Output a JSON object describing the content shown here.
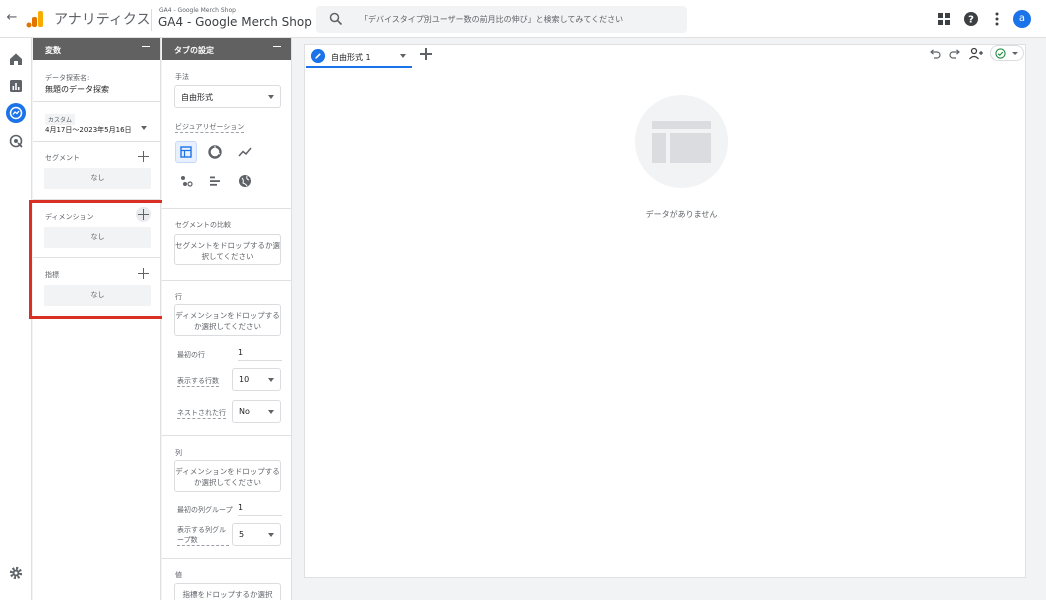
{
  "app": {
    "product_name": "アナリティクス",
    "property_small": "GA4 - Google Merch Shop",
    "property_big": "GA4 - Google Merch Shop",
    "search_placeholder": "「デバイスタイプ別ユーザー数の前月比の伸び」と検索してみてください",
    "avatar_letter": "a"
  },
  "colors": {
    "accent": "#1a73e8",
    "panel_header": "#616161",
    "highlight": "#d93025",
    "logo_orange": "#f9ab00",
    "logo_dark": "#e37400"
  },
  "nav_rail": {
    "icons": [
      "home-icon",
      "reports-icon",
      "explore-icon",
      "advertising-icon",
      "settings-icon"
    ],
    "active": "explore-icon"
  },
  "variables_panel": {
    "title": "変数",
    "exploration_name_label": "データ探索名:",
    "exploration_name": "無題のデータ探索",
    "date_chip": "カスタム",
    "date_range": "4月17日～2023年5月16日",
    "segment_label": "セグメント",
    "segment_value": "なし",
    "dimension_label": "ディメンション",
    "dimension_value": "なし",
    "metric_label": "指標",
    "metric_value": "なし"
  },
  "tab_settings": {
    "title": "タブの設定",
    "technique_label": "手法",
    "technique_value": "自由形式",
    "visualization_label": "ビジュアリゼーション",
    "visualization_icons": [
      "table-icon",
      "donut-chart-icon",
      "line-chart-icon",
      "scatter-plot-icon",
      "bar-chart-icon",
      "globe-icon"
    ],
    "segment_compare_label": "セグメントの比較",
    "segment_drop": "セグメントをドロップするか選択してください",
    "rows_label": "行",
    "rows_drop": "ディメンションをドロップするか選択してください",
    "first_row_label": "最初の行",
    "first_row_value": "1",
    "rows_count_label": "表示する行数",
    "rows_count_value": "10",
    "nested_rows_label": "ネストされた行",
    "nested_rows_value": "No",
    "columns_label": "列",
    "columns_drop": "ディメンションをドロップするか選択してください",
    "first_col_group_label": "最初の列グループ",
    "first_col_group_value": "1",
    "col_groups_label": "表示する列グループ数",
    "col_groups_value": "5",
    "values_label": "値",
    "values_drop": "指標をドロップするか選択"
  },
  "canvas": {
    "tab_name": "自由形式 1",
    "no_data": "データがありません",
    "toolbar_icons": [
      "undo-icon",
      "redo-icon",
      "share-icon",
      "status-check-icon"
    ]
  }
}
